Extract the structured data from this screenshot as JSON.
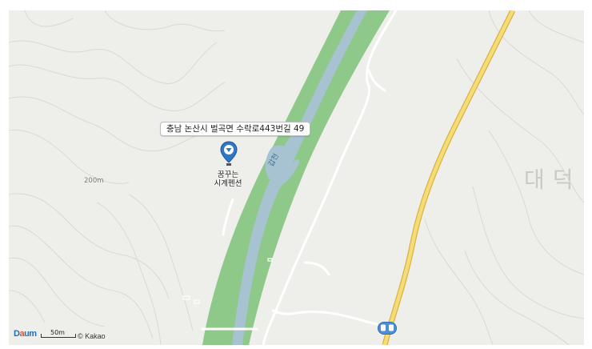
{
  "map": {
    "address_label": "충남 논산시 벌곡면 수락로443번길 49",
    "place_name": "꿈꾸는\n시계펜션",
    "elevation_label": "200m",
    "area_name": "대덕",
    "river_name": "갑천",
    "pin_icon": "location-pin-icon",
    "bus_icon": "bus-stop-icon",
    "colors": {
      "background": "#eeeeea",
      "river_bank": "#8ec98a",
      "water": "#a7c2d1",
      "main_road": "#f2cf5a",
      "pin": "#2f78c6"
    }
  },
  "footer": {
    "logo_a": "D",
    "logo_b": "a",
    "logo_c": "um",
    "scale_label": "50m",
    "copyright": "© Kakao"
  }
}
